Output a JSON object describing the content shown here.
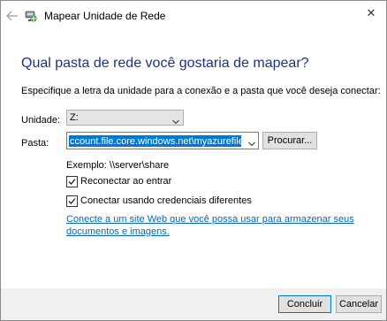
{
  "window": {
    "title": "Mapear Unidade de Rede",
    "close_glyph": "✕"
  },
  "main": {
    "heading": "Qual pasta de rede você gostaria de mapear?",
    "instruction": "Especifique a letra da unidade para a conexão e a pasta que você deseja conectar:",
    "drive_label": "Unidade:",
    "drive_value": "Z:",
    "folder_label": "Pasta:",
    "folder_value": "ccount.file.core.windows.net\\myazurefileshare",
    "browse_label": "Procurar...",
    "example_text": "Exemplo: \\\\server\\share",
    "reconnect_label": "Reconectar ao entrar",
    "reconnect_checked": true,
    "credentials_label": "Conectar usando credenciais diferentes",
    "credentials_checked": true,
    "link_text": "Conecte a um site Web que você possa usar para armazenar seus documentos e imagens."
  },
  "footer": {
    "finish_label": "Concluir",
    "cancel_label": "Cancelar"
  },
  "colors": {
    "heading": "#1e3287",
    "link": "#0066cc",
    "selection": "#0078d7",
    "footer_bg": "#f0f0f0"
  },
  "icons": [
    "back-arrow-icon",
    "network-drive-icon",
    "close-icon",
    "chevron-down-icon",
    "checkmark-icon"
  ]
}
